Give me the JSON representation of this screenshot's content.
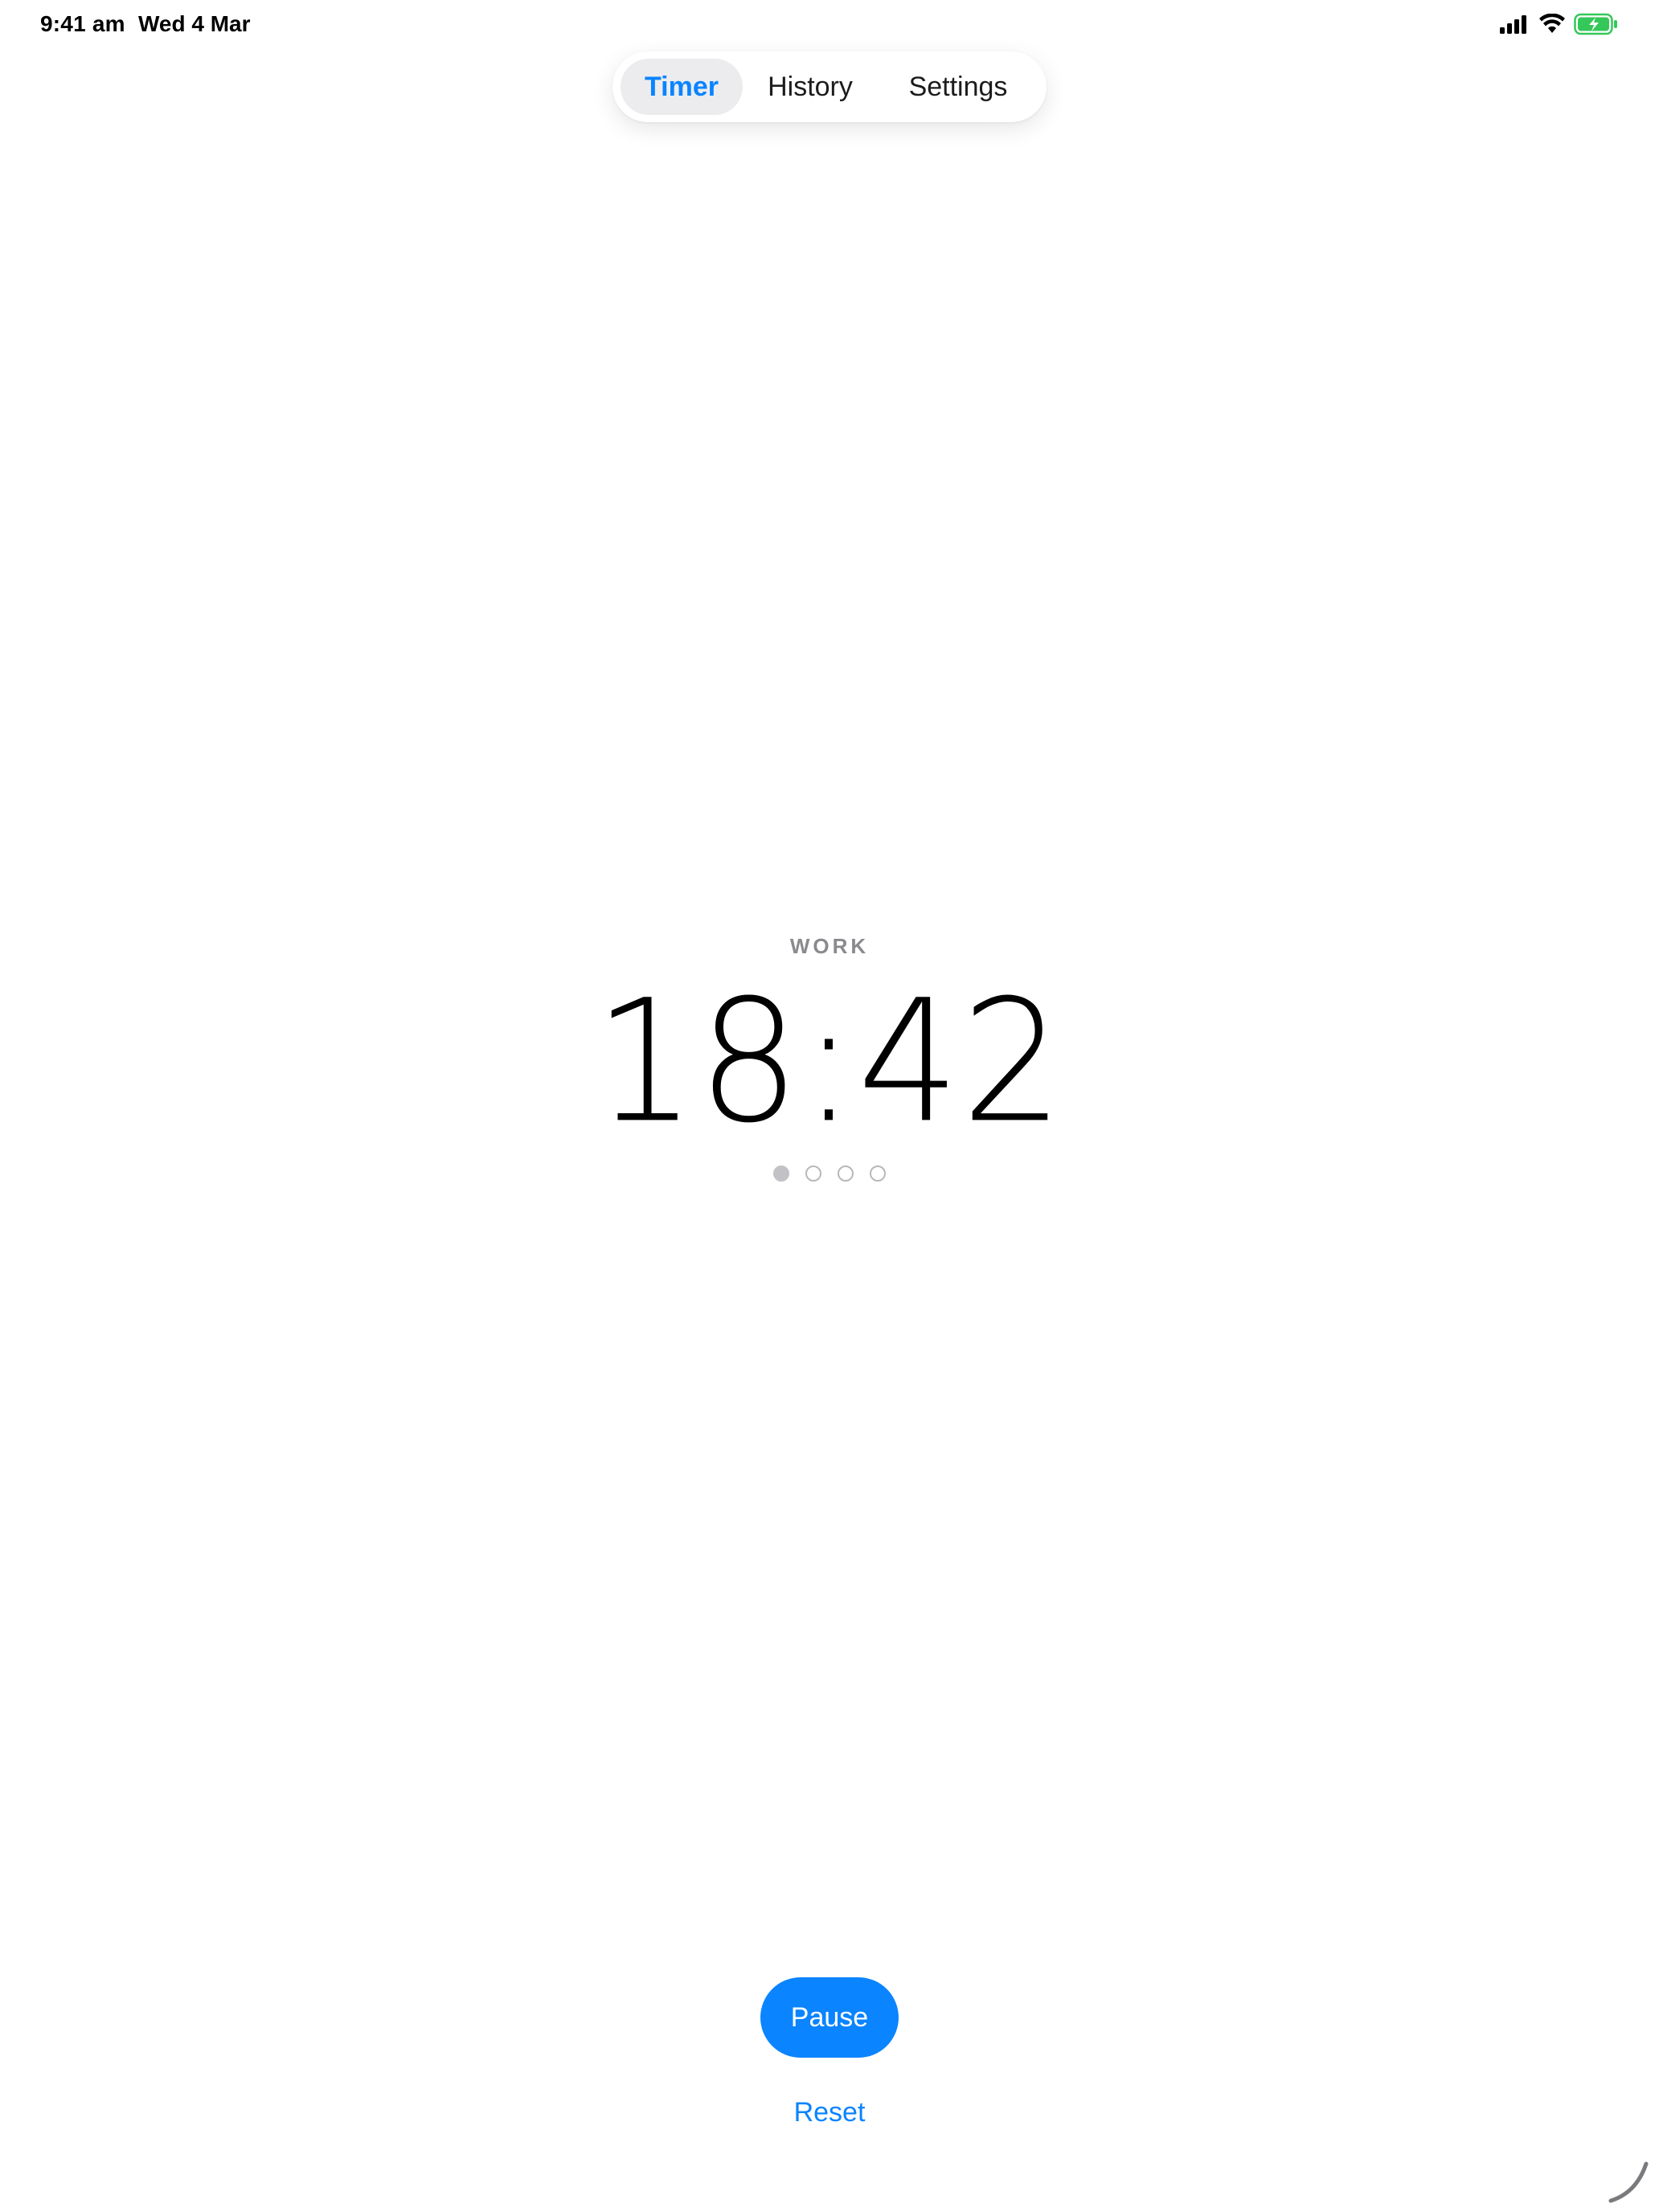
{
  "status_bar": {
    "time": "9:41 am",
    "date": "Wed 4 Mar",
    "icons": [
      "cellular-signal-icon",
      "wifi-icon",
      "battery-charging-icon"
    ],
    "battery_color": "#34c759"
  },
  "tabs": [
    {
      "label": "Timer",
      "active": true
    },
    {
      "label": "History",
      "active": false
    },
    {
      "label": "Settings",
      "active": false
    }
  ],
  "timer": {
    "mode": "WORK",
    "value": "18:42",
    "sessions_total": 4,
    "sessions_completed": 1
  },
  "actions": {
    "primary_label": "Pause",
    "secondary_label": "Reset"
  },
  "colors": {
    "accent": "#0a84ff",
    "tab_active_bg": "#ececee",
    "muted_text": "#8a8a8e"
  }
}
